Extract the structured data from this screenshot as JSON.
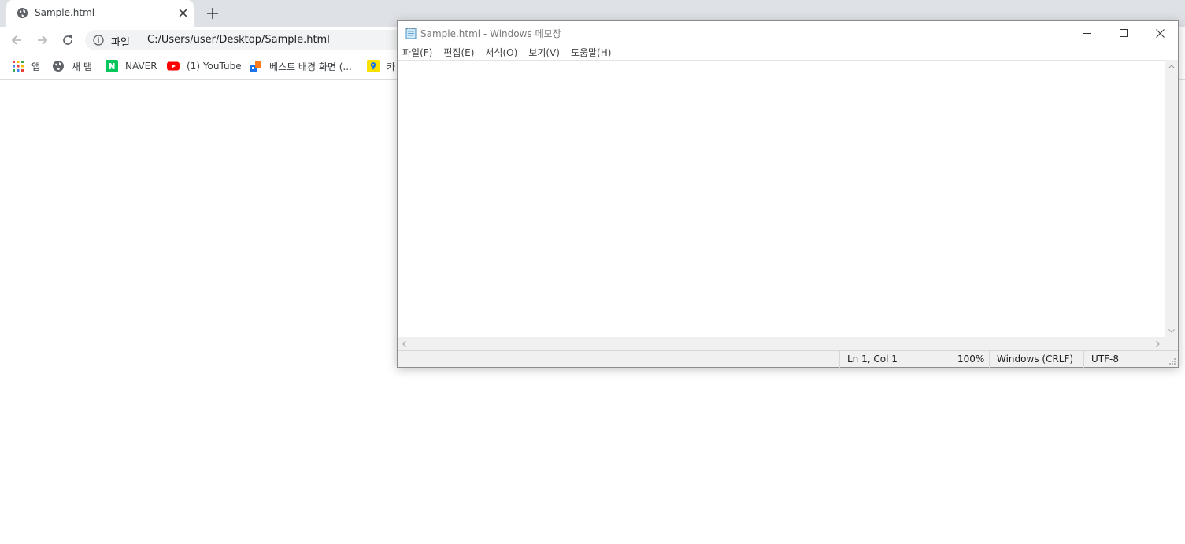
{
  "browser": {
    "tab": {
      "title": "Sample.html",
      "favicon": "globe-icon",
      "close_icon": "close-icon"
    },
    "new_tab_icon": "plus-icon",
    "toolbar": {
      "back_icon": "arrow-left-icon",
      "forward_icon": "arrow-right-icon",
      "reload_icon": "reload-icon",
      "omnibox": {
        "info_icon": "info-icon",
        "scheme_label": "파일",
        "url": "C:/Users/user/Desktop/Sample.html"
      }
    },
    "bookmarks": [
      {
        "label": "앱",
        "icon": "apps-grid-icon"
      },
      {
        "label": "새 탭",
        "icon": "globe-icon"
      },
      {
        "label": "NAVER",
        "icon": "naver-icon"
      },
      {
        "label": "(1) YouTube",
        "icon": "youtube-icon"
      },
      {
        "label": "베스트 배경 화면 (...",
        "icon": "wallpaper-icon"
      },
      {
        "label": "카",
        "icon": "map-pin-icon"
      }
    ]
  },
  "notepad": {
    "title": "Sample.html - Windows 메모장",
    "app_icon": "notepad-icon",
    "window_buttons": [
      "minimize-icon",
      "maximize-icon",
      "close-icon"
    ],
    "menu": [
      "파일(F)",
      "편집(E)",
      "서식(O)",
      "보기(V)",
      "도움말(H)"
    ],
    "content": "",
    "status": {
      "position": "Ln 1, Col 1",
      "zoom": "100%",
      "line_ending": "Windows (CRLF)",
      "encoding": "UTF-8"
    }
  },
  "colors": {
    "tabstrip": "#dee1e6",
    "omnibox": "#f1f3f4",
    "youtube_red": "#ff0000",
    "naver_green": "#03c75a"
  }
}
